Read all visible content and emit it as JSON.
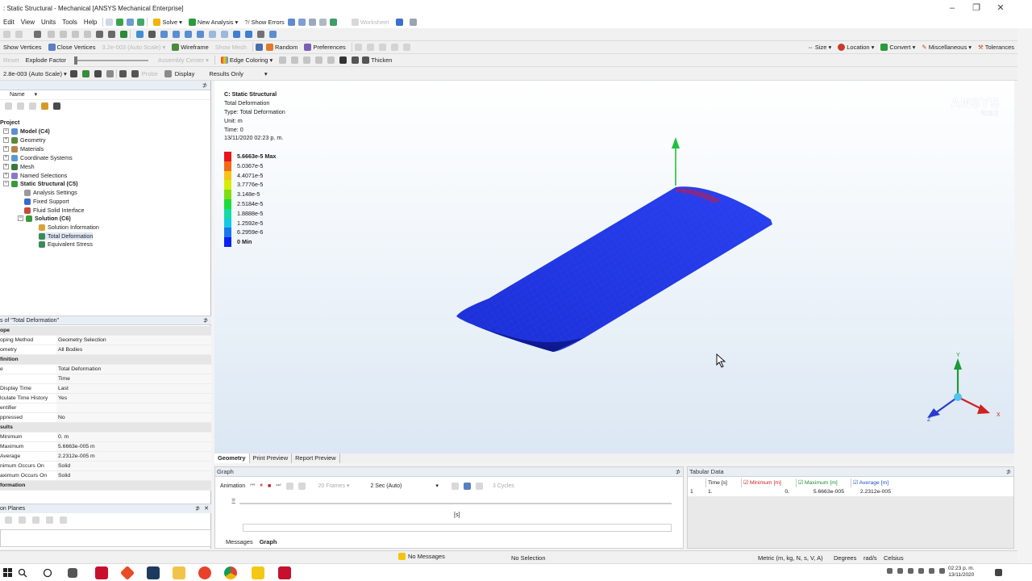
{
  "window": {
    "title": ": Static Structural - Mechanical [ANSYS Mechanical Enterprise]",
    "min": "–",
    "restore": "❐",
    "close": "✕"
  },
  "menu": [
    "Edit",
    "View",
    "Units",
    "Tools",
    "Help"
  ],
  "toolbar1": {
    "solve": "Solve",
    "new_analysis": "New Analysis",
    "show_errors": "Show Errors",
    "worksheet": "Worksheet"
  },
  "toolbar3": {
    "show_vertices": "Show Vertices",
    "close_vertices": "Close Vertices",
    "auto_scale": "3.2e-003 (Auto Scale)",
    "wireframe": "Wireframe",
    "show_mesh": "Show Mesh",
    "random": "Random",
    "preferences": "Preferences",
    "size": "Size",
    "location": "Location",
    "convert": "Convert",
    "miscellaneous": "Miscellaneous",
    "tolerances": "Tolerances"
  },
  "toolbar4": {
    "reset": "Reset",
    "explode_factor": "Explode Factor",
    "assembly_center": "Assembly Center",
    "edge_coloring": "Edge Coloring",
    "thicken": "Thicken"
  },
  "toolbar5": {
    "scale": "2.8e-003 (Auto Scale)",
    "display": "Display",
    "results_only": "Results Only",
    "probe": "Probe"
  },
  "tree_panel": {
    "header_name": "Name",
    "nodes": [
      {
        "label": "Project",
        "bold": true
      },
      {
        "label": "Model (C4)",
        "bold": true
      },
      {
        "label": "Geometry"
      },
      {
        "label": "Materials"
      },
      {
        "label": "Coordinate Systems"
      },
      {
        "label": "Mesh"
      },
      {
        "label": "Named Selections"
      },
      {
        "label": "Static Structural (C5)",
        "bold": true
      },
      {
        "label": "Analysis Settings"
      },
      {
        "label": "Fixed Support"
      },
      {
        "label": "Fluid Solid Interface"
      },
      {
        "label": "Solution (C6)",
        "bold": true
      },
      {
        "label": "Solution Information"
      },
      {
        "label": "Total Deformation"
      },
      {
        "label": "Equivalent Stress"
      }
    ]
  },
  "details": {
    "title": "s of \"Total Deformation\"",
    "rows": [
      {
        "k": "ope",
        "v": "",
        "section": true
      },
      {
        "k": "oping Method",
        "v": "Geometry Selection"
      },
      {
        "k": "ometry",
        "v": "All Bodies"
      },
      {
        "k": "finition",
        "v": "",
        "section": true
      },
      {
        "k": "e",
        "v": "Total Deformation"
      },
      {
        "k": "",
        "v": "Time"
      },
      {
        "k": "Display Time",
        "v": "Last"
      },
      {
        "k": "lculate Time History",
        "v": "Yes"
      },
      {
        "k": "entifier",
        "v": ""
      },
      {
        "k": "ppressed",
        "v": "No"
      },
      {
        "k": "sults",
        "v": "",
        "section": true
      },
      {
        "k": "Minimum",
        "v": "0. m"
      },
      {
        "k": "Maximum",
        "v": "5.6663e-005 m"
      },
      {
        "k": "Average",
        "v": "2.2312e-005 m"
      },
      {
        "k": "nimum Occurs On",
        "v": "Solid"
      },
      {
        "k": "aximum Occurs On",
        "v": "Solid"
      },
      {
        "k": "formation",
        "v": "",
        "section": true
      }
    ]
  },
  "section_planes": {
    "title": "on Planes"
  },
  "viewport": {
    "title": "C: Static Structural",
    "subtitle": "Total Deformation",
    "type": "Type: Total Deformation",
    "unit": "Unit: m",
    "time": "Time: 0",
    "date": "13/11/2020 02:23 p. m.",
    "legend": [
      {
        "label": "5.6663e-5 Max",
        "color": "#e8131b",
        "bold": true
      },
      {
        "label": "5.0367e-5",
        "color": "#f26a16"
      },
      {
        "label": "4.4071e-5",
        "color": "#f7c317"
      },
      {
        "label": "3.7776e-5",
        "color": "#d6ec0d"
      },
      {
        "label": "3.148e-5",
        "color": "#7fdd14"
      },
      {
        "label": "2.5184e-5",
        "color": "#1ddb3a"
      },
      {
        "label": "1.8888e-5",
        "color": "#14dba3"
      },
      {
        "label": "1.2592e-5",
        "color": "#14c8e6"
      },
      {
        "label": "6.2959e-6",
        "color": "#1778ee"
      },
      {
        "label": "0 Min",
        "color": "#0b21f2",
        "bold": true
      }
    ],
    "brand": "ANSYS",
    "version": "R19.2",
    "axis_y": "Y",
    "axis_x": "X",
    "axis_z": "Z"
  },
  "view_tabs": [
    "Geometry",
    "Print Preview",
    "Report Preview"
  ],
  "graph": {
    "title": "Graph",
    "animation": "Animation",
    "frames": "20 Frames",
    "duration": "2 Sec (Auto)",
    "cycles": "3 Cycles",
    "axis_unit": "[s]"
  },
  "tabular": {
    "title": "Tabular Data",
    "headers": [
      "Time [s]",
      "Minimum [m]",
      "Maximum [m]",
      "Average [m]"
    ],
    "header_colors": [
      "#222222",
      "#c8201e",
      "#1f8f2d",
      "#2050c8"
    ],
    "rows": [
      [
        "1.",
        "0.",
        "5.6663e-005",
        "2.2312e-005"
      ]
    ]
  },
  "bottom_tabs": [
    "Messages",
    "Graph"
  ],
  "status": {
    "messages": "No Messages",
    "selection": "No Selection",
    "units": "Metric (m, kg, N, s, V, A)",
    "degrees": "Degrees",
    "rads": "rad/s",
    "temp": "Celsius"
  },
  "clock": {
    "time": "02:23 p. m.",
    "date": "13/11/2020"
  }
}
